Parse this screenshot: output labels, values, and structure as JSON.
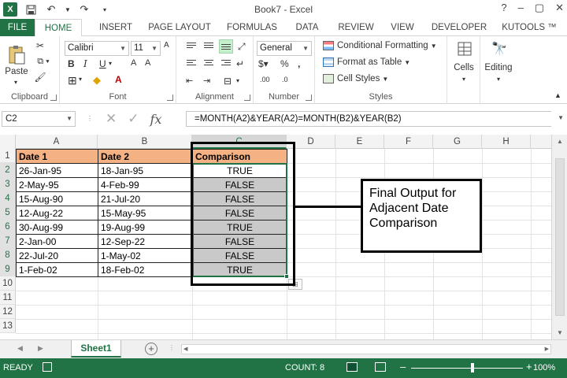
{
  "window": {
    "title": "Book7 - Excel",
    "help": "?",
    "minimize": "–",
    "restore": "▢",
    "close": "✕"
  },
  "tabs": [
    "FILE",
    "HOME",
    "INSERT",
    "PAGE LAYOUT",
    "FORMULAS",
    "DATA",
    "REVIEW",
    "VIEW",
    "DEVELOPER",
    "KUTOOLS ™"
  ],
  "ribbon": {
    "clipboard": {
      "paste": "Paste",
      "label": "Clipboard"
    },
    "font": {
      "name": "Calibri",
      "size": "11",
      "label": "Font"
    },
    "alignment": {
      "label": "Alignment"
    },
    "number": {
      "format": "General",
      "label": "Number"
    },
    "styles": {
      "conditional": "Conditional Formatting",
      "format_table": "Format as Table",
      "cell_styles": "Cell Styles",
      "label": "Styles"
    },
    "cells": {
      "label": "Cells"
    },
    "editing": {
      "label": "Editing"
    }
  },
  "formula_bar": {
    "name_box": "C2",
    "formula": "=MONTH(A2)&YEAR(A2)=MONTH(B2)&YEAR(B2)"
  },
  "grid": {
    "columns": [
      "A",
      "B",
      "C",
      "D",
      "E",
      "F",
      "G",
      "H"
    ],
    "rows": [
      "1",
      "2",
      "3",
      "4",
      "5",
      "6",
      "7",
      "8",
      "9",
      "10",
      "11",
      "12",
      "13"
    ],
    "headers": [
      "Date 1",
      "Date 2",
      "Comparison"
    ],
    "data": [
      [
        "26-Jan-95",
        "18-Jan-95",
        "TRUE"
      ],
      [
        "2-May-95",
        "4-Feb-99",
        "FALSE"
      ],
      [
        "15-Aug-90",
        "21-Jul-20",
        "FALSE"
      ],
      [
        "12-Aug-22",
        "15-May-95",
        "FALSE"
      ],
      [
        "30-Aug-99",
        "19-Aug-99",
        "TRUE"
      ],
      [
        "2-Jan-00",
        "12-Sep-22",
        "FALSE"
      ],
      [
        "22-Jul-20",
        "1-May-02",
        "FALSE"
      ],
      [
        "1-Feb-02",
        "18-Feb-02",
        "TRUE"
      ]
    ]
  },
  "callout": {
    "line1": "Final Output for",
    "line2": "Adjacent Date",
    "line3": "Comparison"
  },
  "sheets": {
    "active": "Sheet1"
  },
  "status": {
    "ready": "READY",
    "count": "COUNT: 8",
    "zoom": "100%"
  },
  "colors": {
    "excel_green": "#217346",
    "header_fill": "#f4b183",
    "false_fill": "#c9c9c9"
  }
}
